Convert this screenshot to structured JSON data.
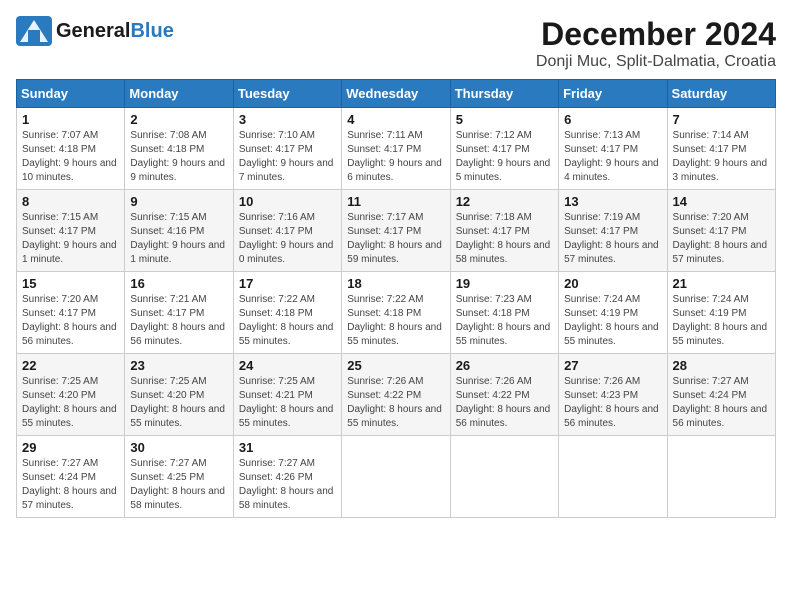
{
  "header": {
    "logo_general": "General",
    "logo_blue": "Blue",
    "month_title": "December 2024",
    "location": "Donji Muc, Split-Dalmatia, Croatia"
  },
  "weekdays": [
    "Sunday",
    "Monday",
    "Tuesday",
    "Wednesday",
    "Thursday",
    "Friday",
    "Saturday"
  ],
  "weeks": [
    [
      {
        "day": "1",
        "sunrise": "7:07 AM",
        "sunset": "4:18 PM",
        "daylight": "9 hours and 10 minutes."
      },
      {
        "day": "2",
        "sunrise": "7:08 AM",
        "sunset": "4:18 PM",
        "daylight": "9 hours and 9 minutes."
      },
      {
        "day": "3",
        "sunrise": "7:10 AM",
        "sunset": "4:17 PM",
        "daylight": "9 hours and 7 minutes."
      },
      {
        "day": "4",
        "sunrise": "7:11 AM",
        "sunset": "4:17 PM",
        "daylight": "9 hours and 6 minutes."
      },
      {
        "day": "5",
        "sunrise": "7:12 AM",
        "sunset": "4:17 PM",
        "daylight": "9 hours and 5 minutes."
      },
      {
        "day": "6",
        "sunrise": "7:13 AM",
        "sunset": "4:17 PM",
        "daylight": "9 hours and 4 minutes."
      },
      {
        "day": "7",
        "sunrise": "7:14 AM",
        "sunset": "4:17 PM",
        "daylight": "9 hours and 3 minutes."
      }
    ],
    [
      {
        "day": "8",
        "sunrise": "7:15 AM",
        "sunset": "4:17 PM",
        "daylight": "9 hours and 1 minute."
      },
      {
        "day": "9",
        "sunrise": "7:15 AM",
        "sunset": "4:16 PM",
        "daylight": "9 hours and 1 minute."
      },
      {
        "day": "10",
        "sunrise": "7:16 AM",
        "sunset": "4:17 PM",
        "daylight": "9 hours and 0 minutes."
      },
      {
        "day": "11",
        "sunrise": "7:17 AM",
        "sunset": "4:17 PM",
        "daylight": "8 hours and 59 minutes."
      },
      {
        "day": "12",
        "sunrise": "7:18 AM",
        "sunset": "4:17 PM",
        "daylight": "8 hours and 58 minutes."
      },
      {
        "day": "13",
        "sunrise": "7:19 AM",
        "sunset": "4:17 PM",
        "daylight": "8 hours and 57 minutes."
      },
      {
        "day": "14",
        "sunrise": "7:20 AM",
        "sunset": "4:17 PM",
        "daylight": "8 hours and 57 minutes."
      }
    ],
    [
      {
        "day": "15",
        "sunrise": "7:20 AM",
        "sunset": "4:17 PM",
        "daylight": "8 hours and 56 minutes."
      },
      {
        "day": "16",
        "sunrise": "7:21 AM",
        "sunset": "4:17 PM",
        "daylight": "8 hours and 56 minutes."
      },
      {
        "day": "17",
        "sunrise": "7:22 AM",
        "sunset": "4:18 PM",
        "daylight": "8 hours and 55 minutes."
      },
      {
        "day": "18",
        "sunrise": "7:22 AM",
        "sunset": "4:18 PM",
        "daylight": "8 hours and 55 minutes."
      },
      {
        "day": "19",
        "sunrise": "7:23 AM",
        "sunset": "4:18 PM",
        "daylight": "8 hours and 55 minutes."
      },
      {
        "day": "20",
        "sunrise": "7:24 AM",
        "sunset": "4:19 PM",
        "daylight": "8 hours and 55 minutes."
      },
      {
        "day": "21",
        "sunrise": "7:24 AM",
        "sunset": "4:19 PM",
        "daylight": "8 hours and 55 minutes."
      }
    ],
    [
      {
        "day": "22",
        "sunrise": "7:25 AM",
        "sunset": "4:20 PM",
        "daylight": "8 hours and 55 minutes."
      },
      {
        "day": "23",
        "sunrise": "7:25 AM",
        "sunset": "4:20 PM",
        "daylight": "8 hours and 55 minutes."
      },
      {
        "day": "24",
        "sunrise": "7:25 AM",
        "sunset": "4:21 PM",
        "daylight": "8 hours and 55 minutes."
      },
      {
        "day": "25",
        "sunrise": "7:26 AM",
        "sunset": "4:22 PM",
        "daylight": "8 hours and 55 minutes."
      },
      {
        "day": "26",
        "sunrise": "7:26 AM",
        "sunset": "4:22 PM",
        "daylight": "8 hours and 56 minutes."
      },
      {
        "day": "27",
        "sunrise": "7:26 AM",
        "sunset": "4:23 PM",
        "daylight": "8 hours and 56 minutes."
      },
      {
        "day": "28",
        "sunrise": "7:27 AM",
        "sunset": "4:24 PM",
        "daylight": "8 hours and 56 minutes."
      }
    ],
    [
      {
        "day": "29",
        "sunrise": "7:27 AM",
        "sunset": "4:24 PM",
        "daylight": "8 hours and 57 minutes."
      },
      {
        "day": "30",
        "sunrise": "7:27 AM",
        "sunset": "4:25 PM",
        "daylight": "8 hours and 58 minutes."
      },
      {
        "day": "31",
        "sunrise": "7:27 AM",
        "sunset": "4:26 PM",
        "daylight": "8 hours and 58 minutes."
      },
      null,
      null,
      null,
      null
    ]
  ]
}
